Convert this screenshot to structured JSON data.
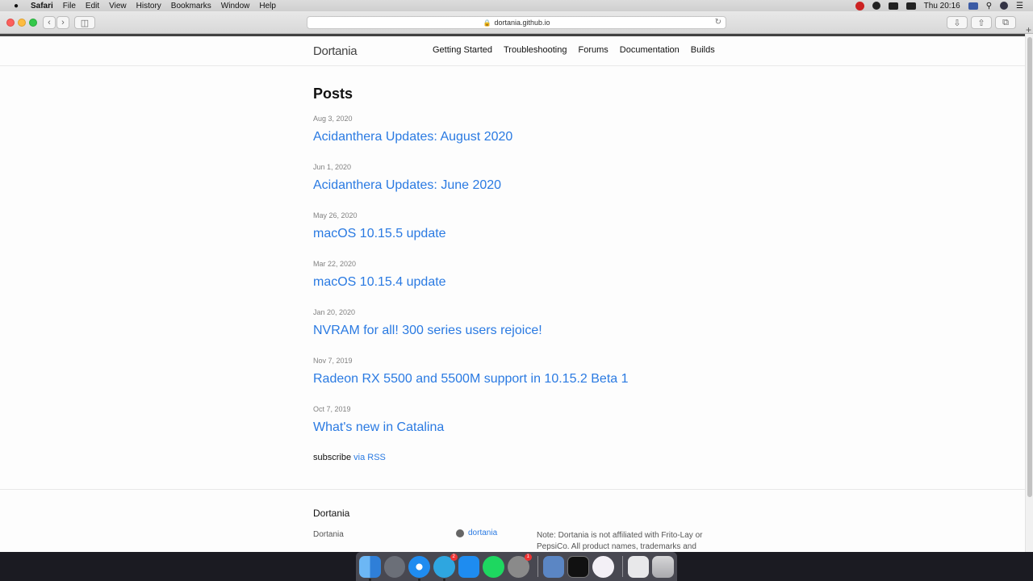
{
  "menubar": {
    "app": "Safari",
    "items": [
      "File",
      "Edit",
      "View",
      "History",
      "Bookmarks",
      "Window",
      "Help"
    ],
    "clock": "Thu 20:16"
  },
  "browser": {
    "url": "dortania.github.io"
  },
  "site": {
    "title": "Dortania",
    "nav": [
      "Getting Started",
      "Troubleshooting",
      "Forums",
      "Documentation",
      "Builds"
    ]
  },
  "main": {
    "heading": "Posts",
    "posts": [
      {
        "date": "Aug 3, 2020",
        "title": "Acidanthera Updates: August 2020"
      },
      {
        "date": "Jun 1, 2020",
        "title": "Acidanthera Updates: June 2020"
      },
      {
        "date": "May 26, 2020",
        "title": "macOS 10.15.5 update"
      },
      {
        "date": "Mar 22, 2020",
        "title": "macOS 10.15.4 update"
      },
      {
        "date": "Jan 20, 2020",
        "title": "NVRAM for all! 300 series users rejoice!"
      },
      {
        "date": "Nov 7, 2019",
        "title": "Radeon RX 5500 and 5500M support in 10.15.2 Beta 1"
      },
      {
        "date": "Oct 7, 2019",
        "title": "What's new in Catalina"
      }
    ],
    "subscribe_label": "subscribe",
    "rss_link": "via RSS"
  },
  "footer": {
    "heading": "Dortania",
    "col1": "Dortania",
    "github_user": "dortania",
    "note": "Note: Dortania is not affiliated with Frito-Lay or PepsiCo. All product names, trademarks and"
  },
  "dock": {
    "telegram_badge": "2",
    "prefs_badge": "1"
  },
  "colors": {
    "link": "#2a7ae2",
    "accent": "#424242"
  }
}
